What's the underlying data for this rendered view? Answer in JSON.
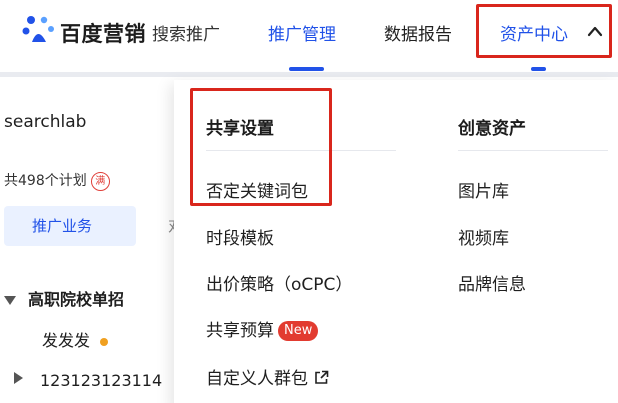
{
  "header": {
    "brand": "百度营销",
    "product": "搜索推广",
    "nav": [
      {
        "label": "推广管理",
        "active": true
      },
      {
        "label": "数据报告",
        "active": false
      },
      {
        "label": "资产中心",
        "active": true
      }
    ],
    "brand_color": "#2152e8"
  },
  "left_panel": {
    "account": "searchlab",
    "plan_count": "共498个计划",
    "full_badge": "满",
    "tab_active": "推广业务",
    "tab_cut": "对",
    "tree": [
      {
        "label": "高职院校单招",
        "expanded": true
      },
      {
        "label": "发发发",
        "status_color": "#f0a020"
      },
      {
        "label": "123123123114",
        "expanded": false
      }
    ]
  },
  "dropdown": {
    "shared": {
      "title": "共享设置",
      "items": [
        "否定关键词包",
        "时段模板",
        "出价策略（oCPC）",
        "共享预算",
        "自定义人群包"
      ],
      "new_badge": "New"
    },
    "creative": {
      "title": "创意资产",
      "items": [
        "图片库",
        "视频库",
        "品牌信息"
      ]
    }
  },
  "annotations": {
    "highlight_color": "#d9261c"
  }
}
